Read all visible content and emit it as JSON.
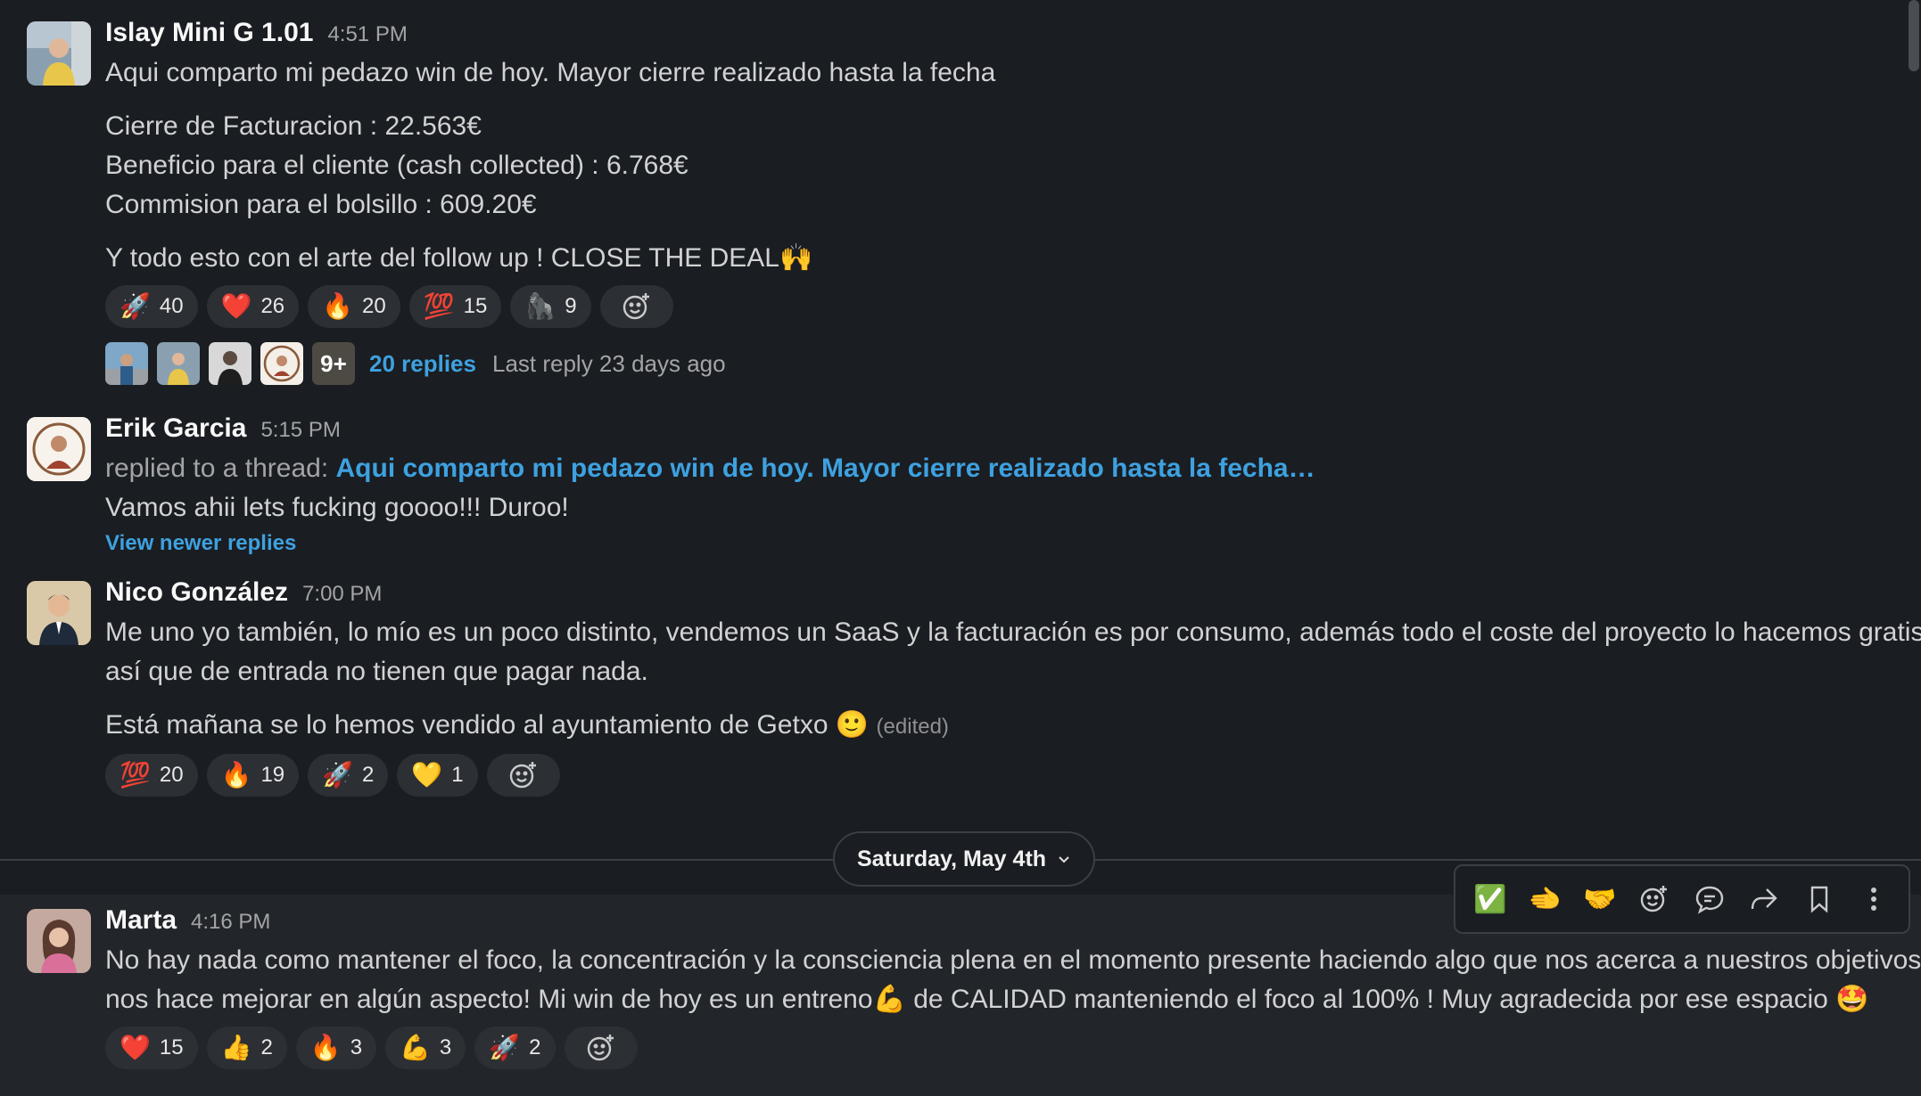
{
  "messages": [
    {
      "author": "Islay Mini G 1.01",
      "time": "4:51 PM",
      "lines": [
        "Aqui comparto mi pedazo win de hoy. Mayor cierre realizado hasta la fecha",
        "Cierre de Facturacion : 22.563€",
        "Beneficio para el cliente (cash collected) : 6.768€",
        "Commision para el bolsillo : 609.20€",
        "Y todo esto con el arte del follow up ! CLOSE THE DEAL"
      ],
      "trailing_emoji": "🙌",
      "reactions": [
        {
          "emoji": "🚀",
          "count": "40"
        },
        {
          "emoji": "❤️",
          "count": "26"
        },
        {
          "emoji": "🔥",
          "count": "20"
        },
        {
          "emoji": "💯",
          "count": "15"
        },
        {
          "emoji": "🦍",
          "count": "9"
        }
      ],
      "thread": {
        "more": "9+",
        "replies": "20 replies",
        "last_reply": "Last reply 23 days ago"
      }
    },
    {
      "author": "Erik Garcia",
      "time": "5:15 PM",
      "replied_prefix": "replied to a thread:",
      "replied_link": "Aqui comparto mi pedazo win de hoy. Mayor cierre realizado hasta la fecha…",
      "text": "Vamos ahii lets fucking goooo!!! Duroo!",
      "view_newer": "View newer replies"
    },
    {
      "author": "Nico González",
      "time": "7:00 PM",
      "lines": [
        "Me uno yo también, lo mío es un poco distinto, vendemos un SaaS y la facturación es por consumo, además todo el coste del proyecto lo hacemos gratis,",
        "así que de entrada no tienen que pagar nada.",
        "Está mañana se lo hemos vendido al ayuntamiento de Getxo"
      ],
      "trailing_emoji": "🙂",
      "edited": "(edited)",
      "reactions": [
        {
          "emoji": "💯",
          "count": "20"
        },
        {
          "emoji": "🔥",
          "count": "19"
        },
        {
          "emoji": "🚀",
          "count": "2"
        },
        {
          "emoji": "💛",
          "count": "1"
        }
      ]
    },
    {
      "author": "Marta",
      "time": "4:16 PM",
      "lines": [
        "No hay nada como mantener el foco, la concentración y la consciencia plena en el momento presente haciendo algo que nos acerca a nuestros objetivos y",
        "nos hace mejorar en algún aspecto! Mi win de hoy es un entreno",
        " de CALIDAD manteniendo el foco al 100% ! Muy agradecida por ese espacio "
      ],
      "inline_emojis": [
        "💪",
        "🤩"
      ],
      "reactions": [
        {
          "emoji": "❤️",
          "count": "15"
        },
        {
          "emoji": "👍",
          "count": "2"
        },
        {
          "emoji": "🔥",
          "count": "3"
        },
        {
          "emoji": "💪",
          "count": "3"
        },
        {
          "emoji": "🚀",
          "count": "2"
        }
      ]
    }
  ],
  "date_divider": "Saturday, May 4th",
  "toolbar": {
    "items": [
      {
        "name": "check-mark-emoji",
        "glyph": "✅"
      },
      {
        "name": "pointing-hand-emoji",
        "glyph": "🫲"
      },
      {
        "name": "handshake-emoji",
        "glyph": "🤝"
      }
    ]
  }
}
